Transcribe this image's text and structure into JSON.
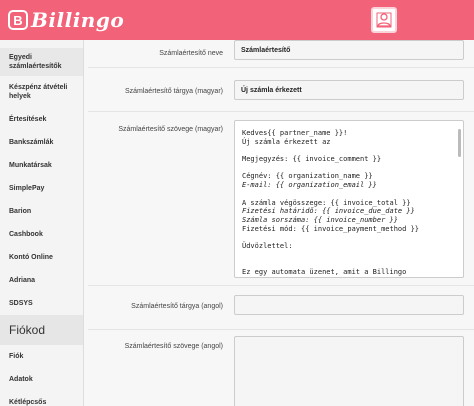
{
  "app": {
    "logo_text": "Billingo",
    "logo_mark": "B",
    "accent": "#f2637a"
  },
  "sidebar": {
    "items": [
      {
        "label": "Egyedi számlaértesítők"
      },
      {
        "label": "Készpénz átvételi helyek"
      },
      {
        "label": "Értesítések"
      },
      {
        "label": "Bankszámlák"
      },
      {
        "label": "Munkatársak"
      },
      {
        "label": "SimplePay"
      },
      {
        "label": "Barion"
      },
      {
        "label": "Cashbook"
      },
      {
        "label": "Kontó Online"
      },
      {
        "label": "Adriana"
      },
      {
        "label": "SDSYS"
      }
    ],
    "section": "Fiókod",
    "items2": [
      {
        "label": "Fiók"
      },
      {
        "label": "Adatok"
      },
      {
        "label": "Kétlépcsős bejelentkezés"
      }
    ]
  },
  "form": {
    "name_label": "Számlaértesítő neve",
    "name_value": "Számlaértesítő",
    "subject_hu_label": "Számlaértesítő tárgya (magyar)",
    "subject_hu_value": "Új számla érkezett",
    "body_hu_label": "Számlaértesítő szövege (magyar)",
    "body_hu_lines": [
      "Kedves{{ partner_name }}!",
      "Új számla érkezett az",
      "",
      "Megjegyzés: {{ invoice_comment }}",
      "",
      "Cégnév: {{ organization_name }}",
      "E-mail: {{ organization_email }}",
      "",
      "A számla végösszege: {{ invoice_total }}",
      "Fizetési határidő: {{ invoice_due_date }}",
      "Számla sorszáma: {{ invoice_number }}",
      "Fizetési mód: {{ invoice_payment_method }}",
      "",
      "Üdvözlettel:",
      "",
      "",
      "Ez egy automata üzenet, amit a Billingo"
    ],
    "subject_en_label": "Számlaértesítő tárgya (angol)",
    "subject_en_value": "",
    "body_en_label": "Számlaértesítő szövege (angol)",
    "body_en_value": ""
  }
}
